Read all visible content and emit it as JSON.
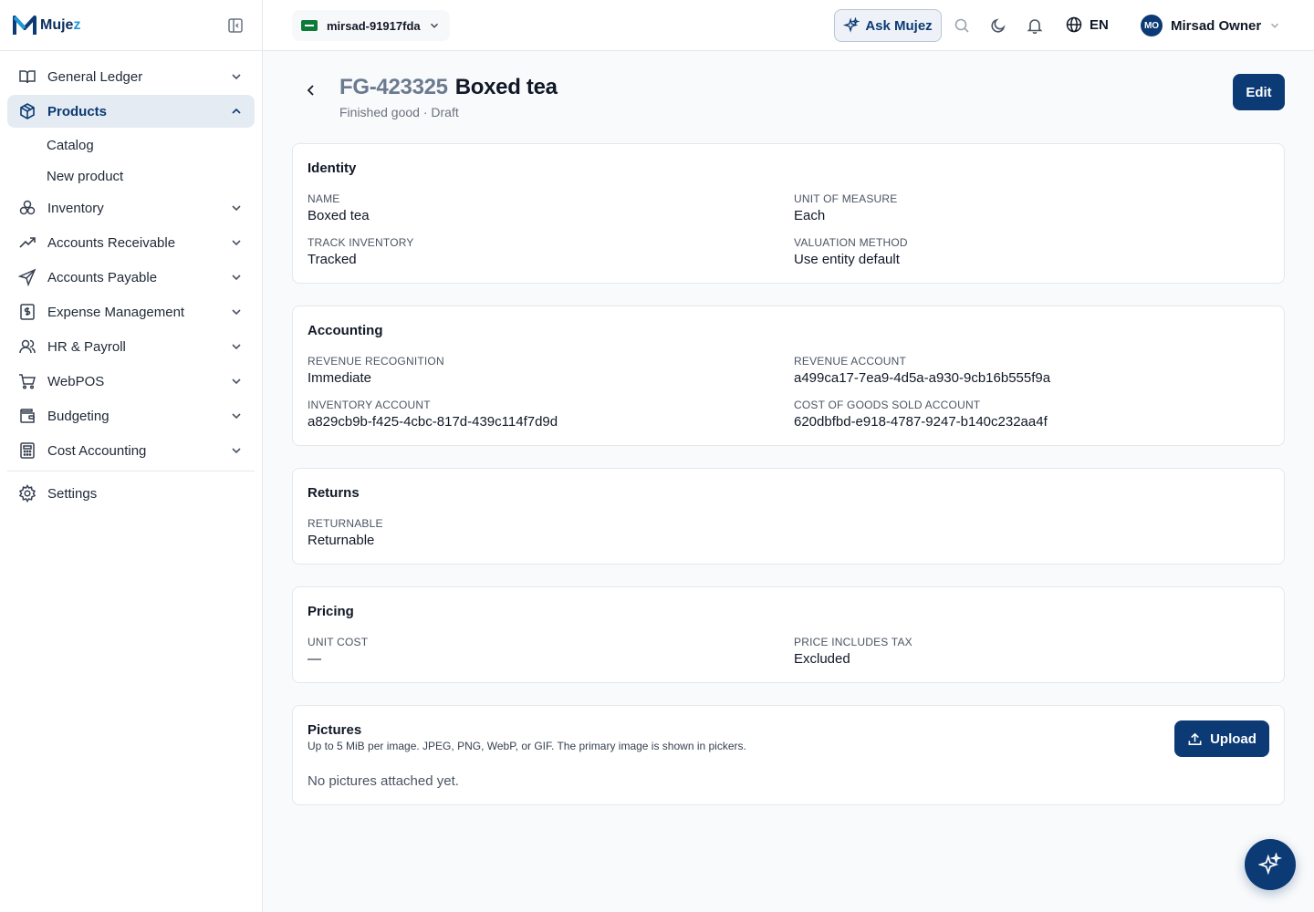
{
  "brand": {
    "name_main": "Muje",
    "name_accent": "z"
  },
  "sidebar": {
    "items": [
      {
        "label": "General Ledger",
        "icon": "book-icon"
      },
      {
        "label": "Products",
        "icon": "box-icon",
        "active": true
      },
      {
        "label": "Inventory",
        "icon": "boxes-icon"
      },
      {
        "label": "Accounts Receivable",
        "icon": "trending-up-icon"
      },
      {
        "label": "Accounts Payable",
        "icon": "send-icon"
      },
      {
        "label": "Expense Management",
        "icon": "receipt-icon"
      },
      {
        "label": "HR & Payroll",
        "icon": "users-icon"
      },
      {
        "label": "WebPOS",
        "icon": "cart-icon"
      },
      {
        "label": "Budgeting",
        "icon": "wallet-icon"
      },
      {
        "label": "Cost Accounting",
        "icon": "calculator-icon"
      },
      {
        "label": "Settings",
        "icon": "gear-icon"
      }
    ],
    "products_sub": [
      "Catalog",
      "New product"
    ]
  },
  "topbar": {
    "tenant": "mirsad-91917fda",
    "ask_label": "Ask Mujez",
    "language": "EN",
    "user_initials": "MO",
    "user_name": "Mirsad Owner"
  },
  "page": {
    "code": "FG-423325",
    "name": "Boxed tea",
    "subtitle": "Finished good · Draft",
    "edit_label": "Edit"
  },
  "identity": {
    "title": "Identity",
    "name_label": "Name",
    "name_value": "Boxed tea",
    "uom_label": "Unit of measure",
    "uom_value": "Each",
    "track_label": "Track inventory",
    "track_value": "Tracked",
    "valuation_label": "Valuation method",
    "valuation_value": "Use entity default"
  },
  "accounting": {
    "title": "Accounting",
    "revrec_label": "Revenue recognition",
    "revrec_value": "Immediate",
    "revacct_label": "Revenue account",
    "revacct_value": "a499ca17-7ea9-4d5a-a930-9cb16b555f9a",
    "invacct_label": "Inventory account",
    "invacct_value": "a829cb9b-f425-4cbc-817d-439c114f7d9d",
    "cogs_label": "Cost of goods sold account",
    "cogs_value": "620dbfbd-e918-4787-9247-b140c232aa4f"
  },
  "returns": {
    "title": "Returns",
    "returnable_label": "Returnable",
    "returnable_value": "Returnable"
  },
  "pricing": {
    "title": "Pricing",
    "unitcost_label": "Unit cost",
    "unitcost_value": "—",
    "taxinc_label": "Price includes tax",
    "taxinc_value": "Excluded"
  },
  "pictures": {
    "title": "Pictures",
    "description": "Up to 5 MiB per image. JPEG, PNG, WebP, or GIF. The primary image is shown in pickers.",
    "upload_label": "Upload",
    "empty_text": "No pictures attached yet."
  },
  "colors": {
    "primary": "#0b3a74",
    "brand_accent": "#1d9bd7"
  }
}
